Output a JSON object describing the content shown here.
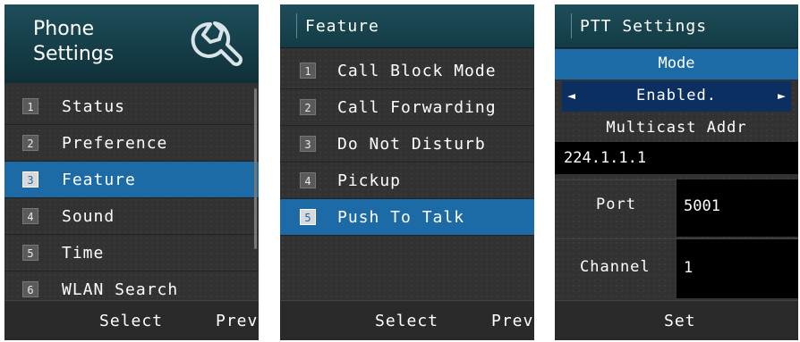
{
  "screen1": {
    "title_line1": "Phone",
    "title_line2": "Settings",
    "header_icon": "wrench-icon",
    "items": [
      {
        "num": "1",
        "label": "Status"
      },
      {
        "num": "2",
        "label": "Preference"
      },
      {
        "num": "3",
        "label": "Feature"
      },
      {
        "num": "4",
        "label": "Sound"
      },
      {
        "num": "5",
        "label": "Time"
      },
      {
        "num": "6",
        "label": "WLAN Search"
      }
    ],
    "selected_index": 2,
    "softkeys": {
      "left": "Select",
      "right": "Prev"
    }
  },
  "screen2": {
    "title": "Feature",
    "items": [
      {
        "num": "1",
        "label": "Call Block Mode"
      },
      {
        "num": "2",
        "label": "Call Forwarding"
      },
      {
        "num": "3",
        "label": "Do Not Disturb"
      },
      {
        "num": "4",
        "label": "Pickup"
      },
      {
        "num": "5",
        "label": "Push To Talk"
      }
    ],
    "selected_index": 4,
    "softkeys": {
      "left": "Select",
      "right": "Prev"
    }
  },
  "screen3": {
    "title": "PTT Settings",
    "mode_label": "Mode",
    "mode_value": "Enabled.",
    "left_arrow": "◄",
    "right_arrow": "►",
    "multicast_label": "Multicast Addr",
    "multicast_value": "224.1.1.1",
    "port_label": "Port",
    "port_value": "5001",
    "channel_label": "Channel",
    "channel_value": "1",
    "softkey": "Set"
  },
  "colors": {
    "selection": "#1c6aa6",
    "header": "#1d4e5a",
    "background": "#323232",
    "enabled_bar": "#0c2f62"
  }
}
